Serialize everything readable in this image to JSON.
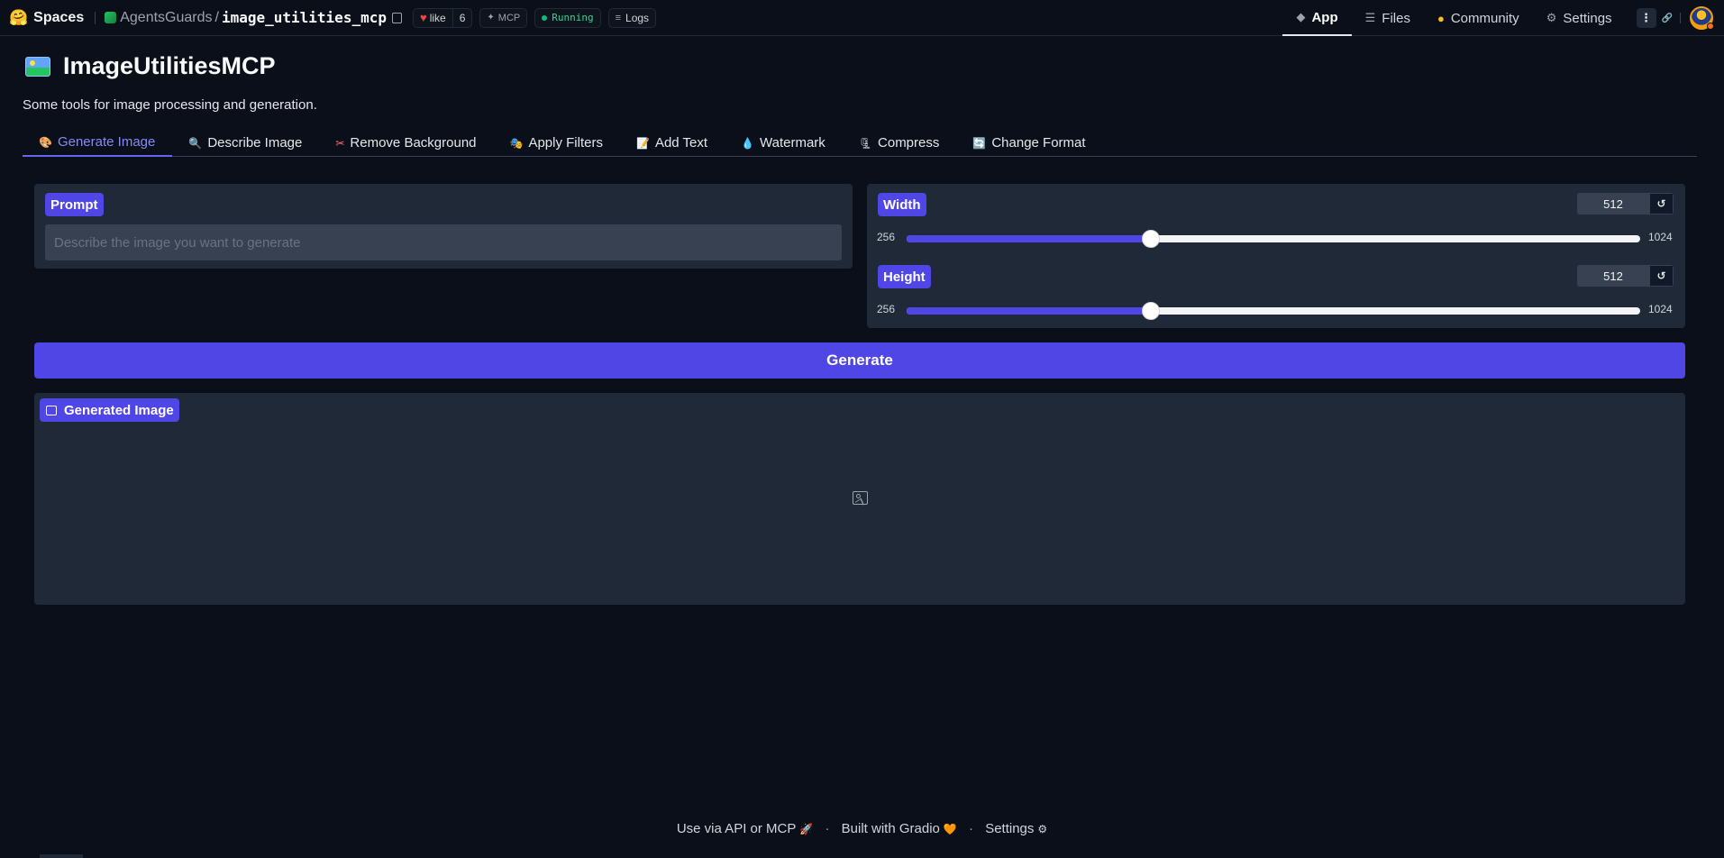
{
  "topbar": {
    "spaces_label": "Spaces",
    "owner": "AgentsGuards",
    "separator": "/",
    "repo": "image_utilities_mcp",
    "like_label": "like",
    "like_count": "6",
    "mcp_label": "MCP",
    "status": "Running",
    "logs_label": "Logs",
    "nav": {
      "app": "App",
      "files": "Files",
      "community": "Community",
      "settings": "Settings"
    }
  },
  "app": {
    "title": "ImageUtilitiesMCP",
    "subtitle": "Some tools for image processing and generation."
  },
  "tabs": [
    {
      "icon": "🎨",
      "label": "Generate Image"
    },
    {
      "icon": "🔍",
      "label": "Describe Image"
    },
    {
      "icon": "✂",
      "label": "Remove Background"
    },
    {
      "icon": "🎭",
      "label": "Apply Filters"
    },
    {
      "icon": "📝",
      "label": "Add Text"
    },
    {
      "icon": "💧",
      "label": "Watermark"
    },
    {
      "icon": "🗜",
      "label": "Compress"
    },
    {
      "icon": "🔄",
      "label": "Change Format"
    }
  ],
  "prompt": {
    "label": "Prompt",
    "placeholder": "Describe the image you want to generate",
    "value": ""
  },
  "width": {
    "label": "Width",
    "value": "512",
    "min": "256",
    "max": "1024",
    "fraction": 0.3333
  },
  "height": {
    "label": "Height",
    "value": "512",
    "min": "256",
    "max": "1024",
    "fraction": 0.3333
  },
  "reset_glyph": "↺",
  "generate_label": "Generate",
  "output": {
    "label": "Generated Image"
  },
  "footer": {
    "api": "Use via API or MCP",
    "api_icon": "🚀",
    "sep": "·",
    "built": "Built with Gradio",
    "built_icon": "🧡",
    "settings": "Settings",
    "settings_icon": "⚙"
  },
  "colors": {
    "accent": "#4f46e5",
    "background": "#0b0f19",
    "panel": "#1f2937",
    "active_tab": "#818cf8",
    "running": "#34d399"
  }
}
